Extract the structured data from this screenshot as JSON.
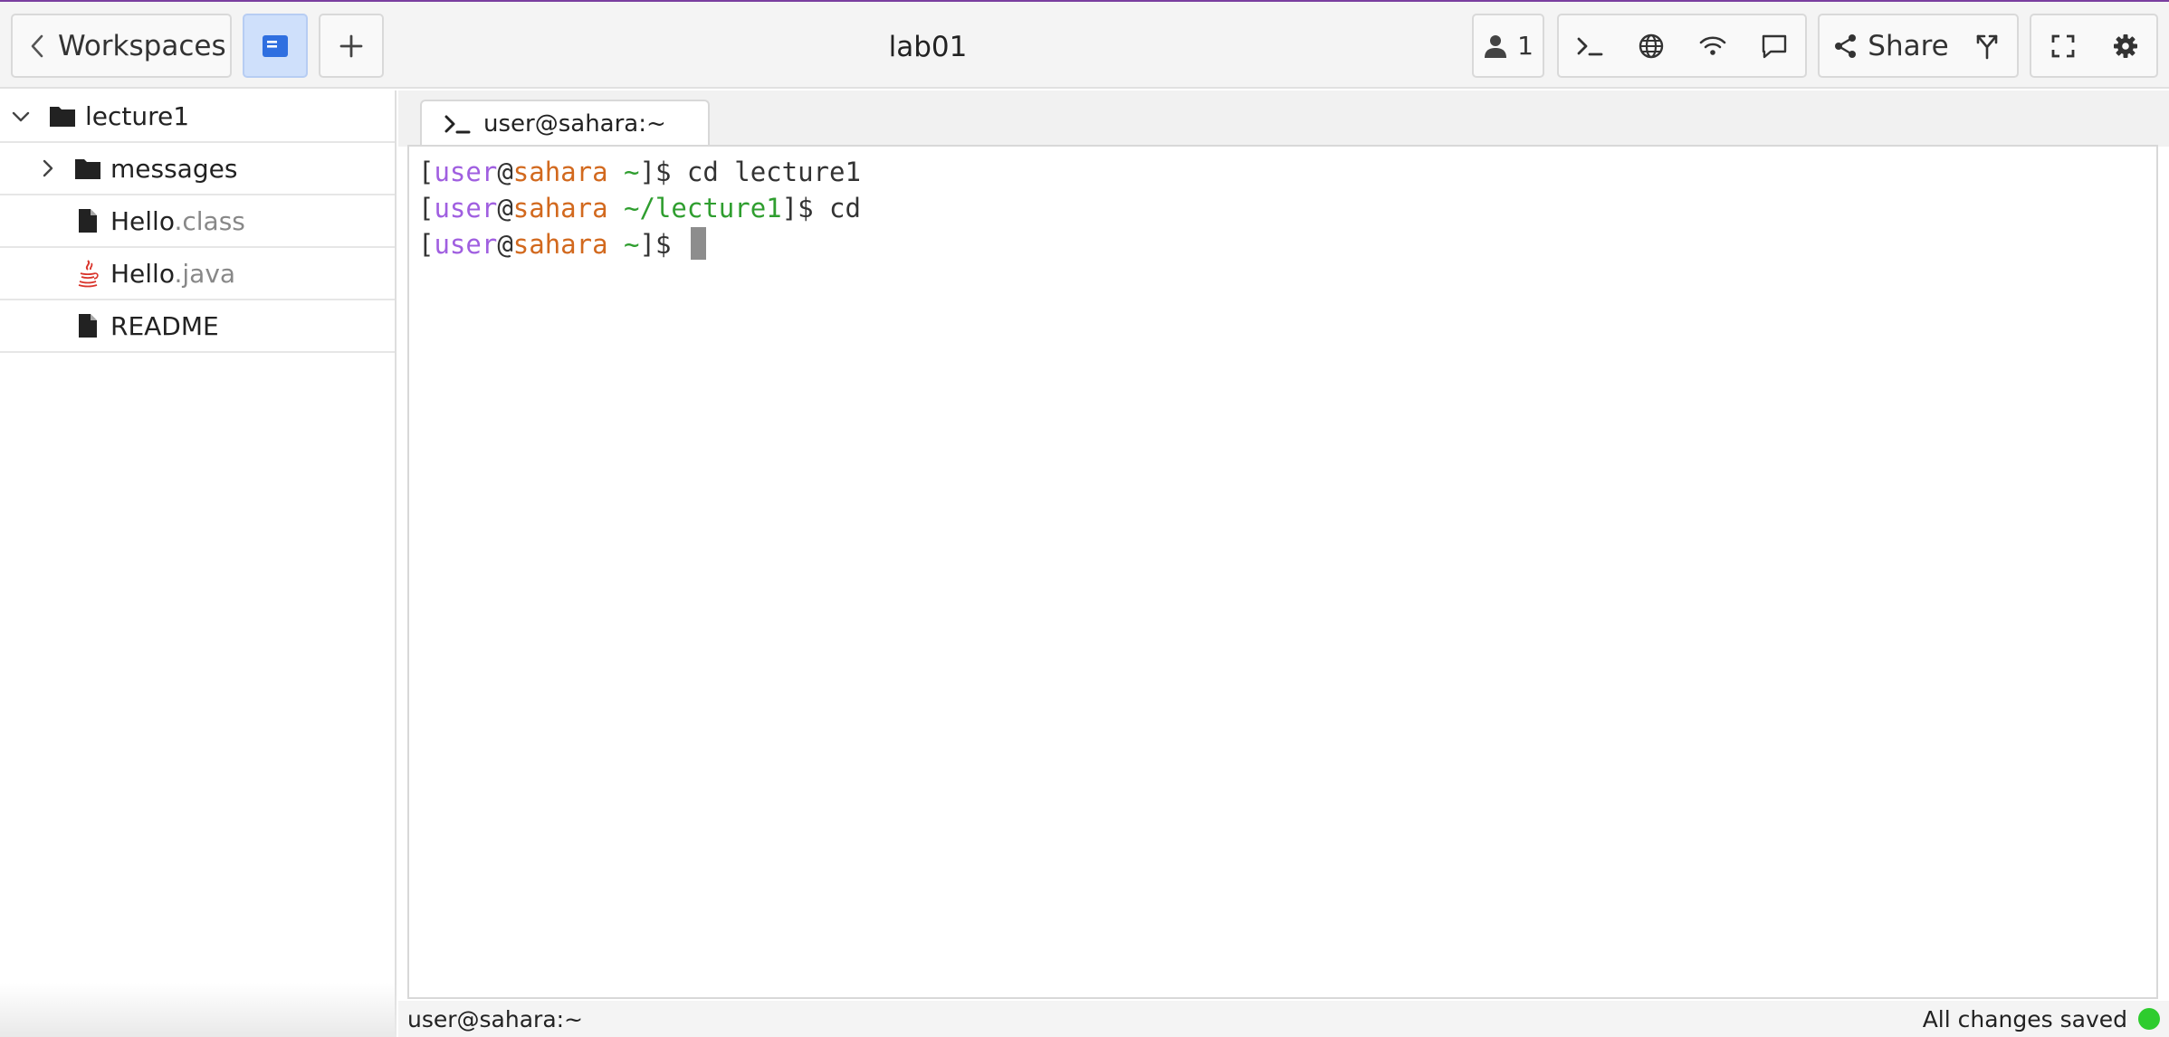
{
  "toolbar": {
    "back_label": "Workspaces",
    "title": "lab01",
    "user_count": "1",
    "share_label": "Share"
  },
  "sidebar": {
    "root": {
      "name": "lecture1"
    },
    "items": [
      {
        "name": "messages",
        "ext": ""
      },
      {
        "name": "Hello",
        "ext": ".class"
      },
      {
        "name": "Hello",
        "ext": ".java"
      },
      {
        "name": "README",
        "ext": ""
      }
    ]
  },
  "terminal": {
    "tab_label": "user@sahara:~",
    "lines": [
      {
        "user": "user",
        "host": "sahara",
        "path": "~",
        "command": "cd lecture1"
      },
      {
        "user": "user",
        "host": "sahara",
        "path": "~/lecture1",
        "command": "cd"
      },
      {
        "user": "user",
        "host": "sahara",
        "path": "~",
        "command": ""
      }
    ]
  },
  "status": {
    "left": "user@sahara:~",
    "right": "All changes saved"
  },
  "colors": {
    "accent_blue": "#2f6fe0",
    "prompt_user": "#a05fe0",
    "prompt_host": "#d2691e",
    "prompt_path": "#2f9e2f",
    "saved_indicator": "#2ecc2e"
  }
}
